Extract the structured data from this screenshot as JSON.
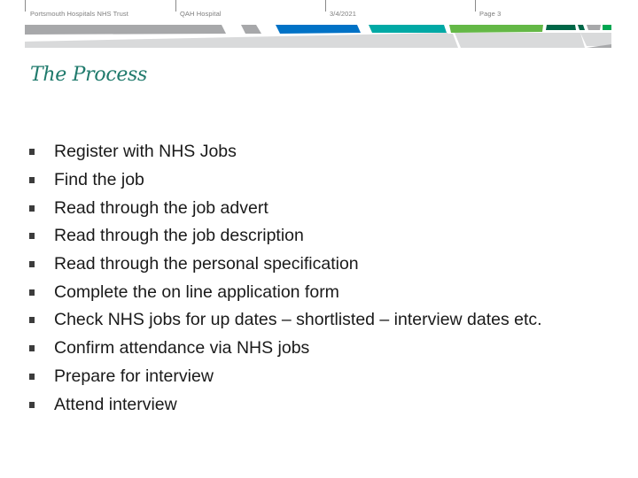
{
  "header": {
    "organization": "Portsmouth Hospitals NHS Trust",
    "site": "QAH Hospital",
    "date": "3/4/2021",
    "page": "Page 3"
  },
  "banner": {
    "colors": {
      "grey_dark": "#a7a8aa",
      "grey_light": "#d9dadb",
      "blue": "#0072c6",
      "teal": "#00a9a5",
      "green": "#64b846",
      "dark_green": "#006747",
      "bright_green": "#00a651"
    }
  },
  "slide": {
    "title": "The Process",
    "title_color": "#1f7a6c",
    "bullets": [
      "Register with NHS Jobs",
      "Find the job",
      "Read through the job advert",
      "Read through the job description",
      "Read through the personal specification",
      "Complete the on line application form",
      "Check NHS jobs for up dates – shortlisted – interview dates etc.",
      "Confirm attendance via NHS jobs",
      "Prepare for interview",
      "Attend interview"
    ]
  }
}
